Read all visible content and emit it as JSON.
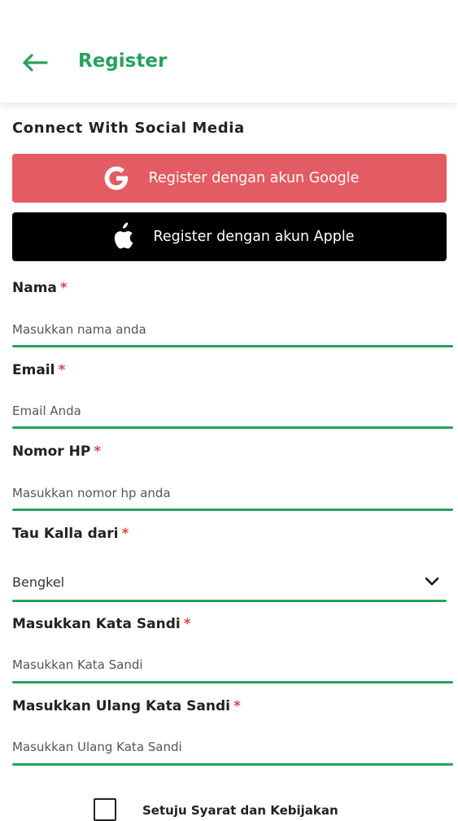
{
  "header": {
    "title": "Register",
    "back_icon": "arrow-left-icon",
    "accent": "#27a15f"
  },
  "social": {
    "title": "Connect With Social Media",
    "google": {
      "label": "Register dengan akun Google",
      "icon": "google-icon",
      "color": "#e45c63"
    },
    "apple": {
      "label": "Register dengan akun Apple",
      "icon": "apple-icon",
      "color": "#000000"
    }
  },
  "form": {
    "required_mark": "*",
    "nama": {
      "label": "Nama",
      "placeholder": "Masukkan nama anda",
      "value": ""
    },
    "email": {
      "label": "Email",
      "placeholder": "Email Anda",
      "value": ""
    },
    "phone": {
      "label": "Nomor HP",
      "placeholder": "Masukkan nomor hp anda",
      "value": ""
    },
    "source": {
      "label": "Tau Kalla dari",
      "selected": "Bengkel",
      "icon": "chevron-down-icon"
    },
    "password": {
      "label": "Masukkan Kata Sandi",
      "placeholder": "Masukkan Kata Sandi",
      "value": ""
    },
    "password_confirm": {
      "label": "Masukkan Ulang Kata Sandi",
      "placeholder": "Masukkan Ulang Kata Sandi",
      "value": ""
    }
  },
  "agreement": {
    "label": "Setuju Syarat dan Kebijakan",
    "checked": false
  }
}
